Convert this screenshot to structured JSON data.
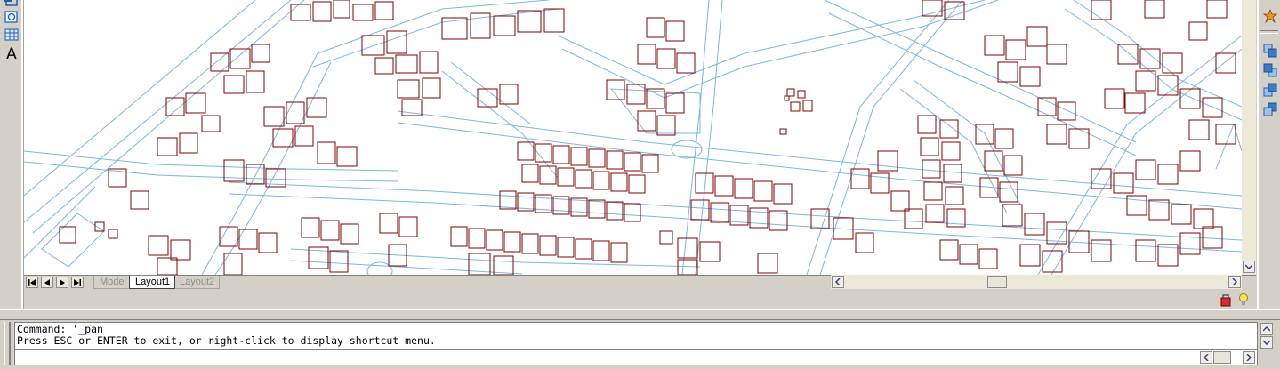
{
  "layout_tabs": [
    {
      "label": "Model",
      "active": false
    },
    {
      "label": "Layout1",
      "active": true
    },
    {
      "label": "Layout2",
      "active": false
    }
  ],
  "left_toolbar": {
    "tools": [
      "insert-block-icon",
      "make-block-icon",
      "table-icon",
      "multiline-text-icon"
    ],
    "text_tool_glyph": "A"
  },
  "right_toolbar": {
    "tools": [
      "explode-icon",
      "draw-order-front-icon",
      "draw-order-back-icon",
      "draw-order-above-icon",
      "draw-order-below-icon"
    ]
  },
  "command_window": {
    "line1": "Command: '_pan",
    "line2": "Press ESC or ENTER to exit, or right-click to display shortcut menu.",
    "input_value": ""
  },
  "status_tray": {
    "icons": [
      "toolbar-lock-icon",
      "clean-screen-icon"
    ]
  },
  "colors": {
    "building_outline": "#800000",
    "road_outline": "#7ab8e0",
    "drawing_background": "#ffffff",
    "ui_face": "#d4d0c8"
  }
}
